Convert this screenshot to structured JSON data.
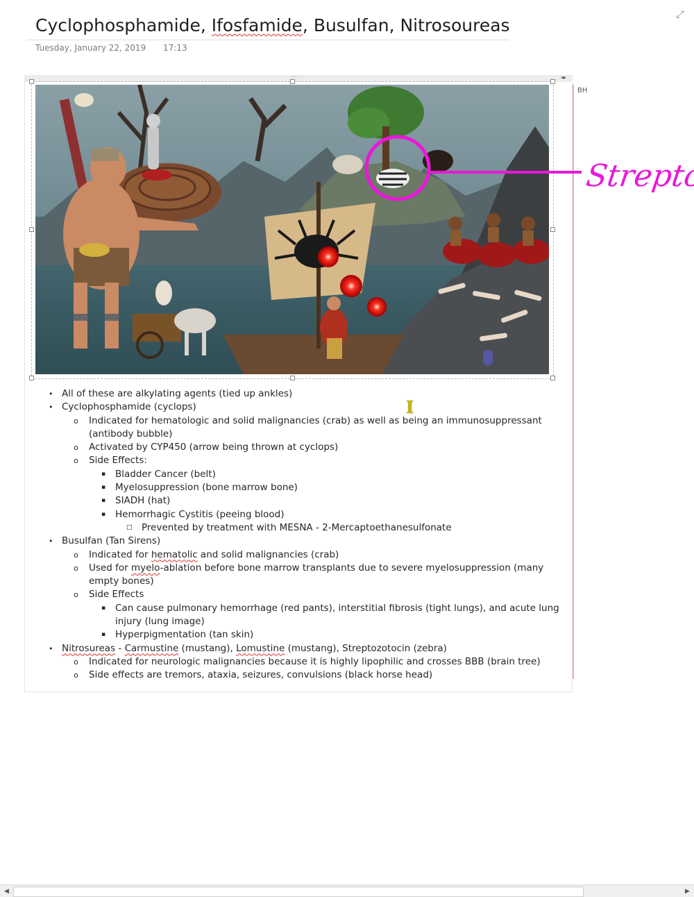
{
  "page": {
    "title_parts": [
      "Cyclophosphamide, ",
      "Ifosfamide",
      ", Busulfan, Nitrosoureas"
    ],
    "date": "Tuesday, January 22, 2019",
    "time": "17:13",
    "author_initials": "BH"
  },
  "annotation": {
    "ink_text": "Streptoc",
    "ink_color": "#e818d8"
  },
  "notes": [
    {
      "level": 1,
      "parts": [
        {
          "t": "All of these are alkylating agents (tied up ankles)"
        }
      ]
    },
    {
      "level": 1,
      "parts": [
        {
          "t": "Cyclophosphamide (cyclops)"
        }
      ]
    },
    {
      "level": 2,
      "parts": [
        {
          "t": "Indicated for hematologic and solid malignancies (crab) as well as being an immunosuppressant (antibody bubble)"
        }
      ]
    },
    {
      "level": 2,
      "parts": [
        {
          "t": "Activated by CYP450 (arrow being thrown at cyclops)"
        }
      ]
    },
    {
      "level": 2,
      "parts": [
        {
          "t": "Side Effects:"
        }
      ]
    },
    {
      "level": 3,
      "parts": [
        {
          "t": "Bladder Cancer (belt)"
        }
      ]
    },
    {
      "level": 3,
      "parts": [
        {
          "t": "Myelosuppression (bone marrow bone)"
        }
      ]
    },
    {
      "level": 3,
      "parts": [
        {
          "t": "SIADH (hat)"
        }
      ]
    },
    {
      "level": 3,
      "parts": [
        {
          "t": "Hemorrhagic Cystitis (peeing blood)"
        }
      ]
    },
    {
      "level": 4,
      "parts": [
        {
          "t": "Prevented by treatment with MESNA - 2-Mercaptoethanesulfonate"
        }
      ]
    },
    {
      "level": 1,
      "parts": [
        {
          "t": "Busulfan (Tan Sirens)"
        }
      ]
    },
    {
      "level": 2,
      "parts": [
        {
          "t": "Indicated for "
        },
        {
          "t": "hematolic",
          "sq": true
        },
        {
          "t": " and solid malignancies (crab)"
        }
      ]
    },
    {
      "level": 2,
      "parts": [
        {
          "t": "Used for "
        },
        {
          "t": "myelo",
          "sq": true
        },
        {
          "t": "-ablation before bone marrow transplants due to severe myelosuppression (many empty bones)"
        }
      ]
    },
    {
      "level": 2,
      "parts": [
        {
          "t": "Side Effects"
        }
      ]
    },
    {
      "level": 3,
      "parts": [
        {
          "t": "Can cause pulmonary hemorrhage (red pants), interstitial fibrosis (tight lungs), and acute lung injury (lung image)"
        }
      ]
    },
    {
      "level": 3,
      "parts": [
        {
          "t": "Hyperpigmentation (tan skin)"
        }
      ]
    },
    {
      "level": 1,
      "parts": [
        {
          "t": "Nitrosureas",
          "sq": true
        },
        {
          "t": " - "
        },
        {
          "t": "Carmustine",
          "sq": true
        },
        {
          "t": " (mustang), "
        },
        {
          "t": "Lomustine",
          "sq": true
        },
        {
          "t": " (mustang), Streptozotocin (zebra)"
        }
      ]
    },
    {
      "level": 2,
      "parts": [
        {
          "t": "Indicated for neurologic malignancies because it is highly lipophilic and crosses BBB (brain tree)"
        }
      ]
    },
    {
      "level": 2,
      "parts": [
        {
          "t": "Side effects are tremors, ataxia, seizures, convulsions (black horse head)"
        }
      ]
    }
  ],
  "bullets": {
    "1": "•",
    "2": "o",
    "3": "▪",
    "4": "□"
  },
  "icons": {
    "expand": "expand-icon",
    "cursor": "text-cursor-icon",
    "scroll_left": "scroll-left-icon",
    "scroll_right": "scroll-right-icon"
  }
}
